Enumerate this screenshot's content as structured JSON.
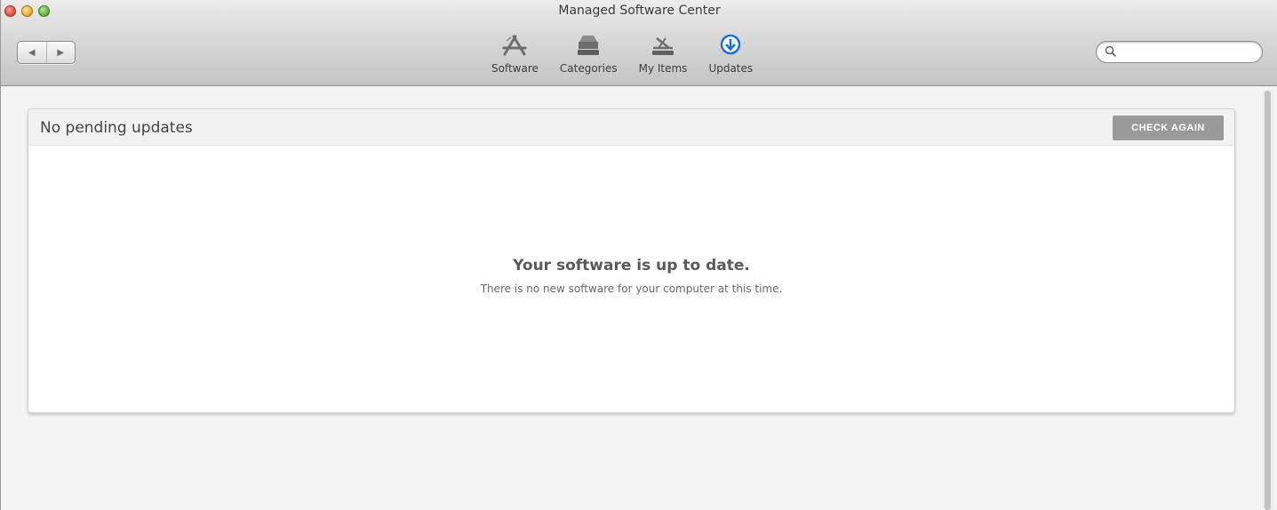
{
  "window": {
    "title": "Managed Software Center"
  },
  "nav": {
    "back_glyph": "◀",
    "forward_glyph": "▶"
  },
  "toolbar": {
    "items": [
      {
        "label": "Software",
        "icon": "app-store-icon"
      },
      {
        "label": "Categories",
        "icon": "categories-tray-icon"
      },
      {
        "label": "My Items",
        "icon": "my-items-icon"
      },
      {
        "label": "Updates",
        "icon": "download-arrow-icon",
        "active": true
      }
    ]
  },
  "search": {
    "placeholder": "",
    "value": ""
  },
  "panel": {
    "title": "No pending updates",
    "check_button_label": "CHECK AGAIN",
    "empty_title": "Your software is up to date.",
    "empty_subtitle": "There is no new software for your computer at this time."
  },
  "colors": {
    "accent": "#1f6fd6",
    "button_gray": "#9a9a9a",
    "close": "#e0443a",
    "minimize": "#e8a623",
    "zoom": "#52ad36"
  }
}
